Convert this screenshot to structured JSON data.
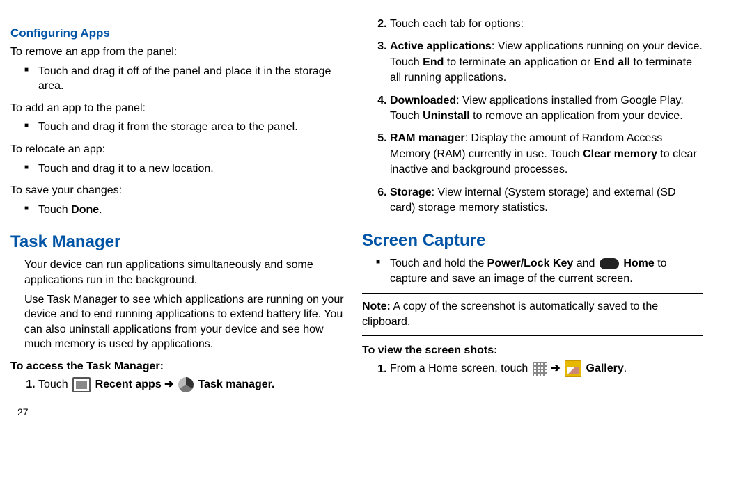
{
  "left": {
    "configuringHeading": "Configuring Apps",
    "removeIntro": "To remove an app from the panel:",
    "removeBullet": "Touch and drag it off of the panel and place it in the storage area.",
    "addIntro": "To add an app to the panel:",
    "addBullet": "Touch and drag it from the storage area to the panel.",
    "relocateIntro": "To relocate an app:",
    "relocateBullet": "Touch and drag it to a new location.",
    "saveIntro": "To save your changes:",
    "saveBulletPrefix": "Touch ",
    "saveBulletBold": "Done",
    "saveBulletSuffix": ".",
    "taskManagerHeading": "Task Manager",
    "taskManagerP1": "Your device can run applications simultaneously and some applications run in the background.",
    "taskManagerP2": "Use Task Manager to see which applications are running on your device and to end running applications to extend battery life. You can also uninstall applications from your device and see how much memory is used by applications.",
    "taskManagerSub": "To access the Task Manager:",
    "step1a": "Touch ",
    "step1b": " Recent apps ",
    "step1arr": "➔",
    "step1d": " Task manager.",
    "pageNum": "27"
  },
  "right": {
    "step2": "Touch each tab for options:",
    "step3bold": "Active applications",
    "step3a": ": View applications running on your device. Touch ",
    "step3b": "End",
    "step3c": " to terminate an application or ",
    "step3d": "End all",
    "step3e": " to terminate all running applications.",
    "step4bold": "Downloaded",
    "step4a": ": View applications installed from Google Play. Touch ",
    "step4b": "Uninstall",
    "step4c": " to remove an application from your device.",
    "step5bold": "RAM manager",
    "step5a": ": Display the amount of Random Access Memory (RAM) currently in use. Touch ",
    "step5b": "Clear memory",
    "step5c": " to clear inactive and background processes.",
    "step6bold": "Storage",
    "step6a": ": View internal (System storage) and external (SD card) storage memory statistics.",
    "screenCaptureHeading": "Screen Capture",
    "sc1a": "Touch and hold the ",
    "sc1b": "Power/Lock Key",
    "sc1c": " and ",
    "sc1e": " Home",
    "sc1f": " to capture and save an image of the current screen.",
    "noteLabel": "Note:",
    "noteText": " A copy of the screenshot is automatically saved to the clipboard.",
    "viewSub": "To view the screen shots:",
    "view1a": "From a Home screen, touch ",
    "viewArr": "➔",
    "view1d": " Gallery",
    "view1e": "."
  }
}
